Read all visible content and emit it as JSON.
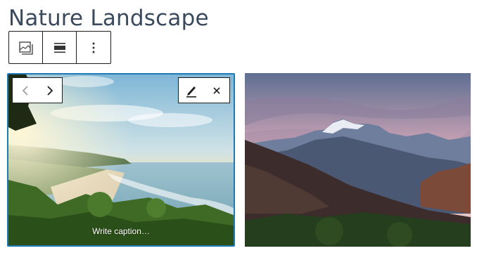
{
  "page": {
    "title": "Nature Landscape"
  },
  "block_toolbar": {
    "icons": [
      "gallery-icon",
      "align-icon",
      "more-options-icon"
    ]
  },
  "gallery": {
    "images": [
      {
        "description_icon": "beach-landscape",
        "selected": true,
        "caption_placeholder": "Write caption…"
      },
      {
        "description_icon": "mountain-landscape",
        "selected": false
      }
    ]
  },
  "image_nav": {
    "icons": [
      "chevron-left-icon",
      "chevron-right-icon"
    ]
  },
  "image_edit": {
    "icons": [
      "pencil-icon",
      "close-icon"
    ]
  },
  "colors": {
    "selection_border": "#1e7bb8",
    "title": "#3a4a5c",
    "toolbar_border": "#1e1e1e"
  }
}
